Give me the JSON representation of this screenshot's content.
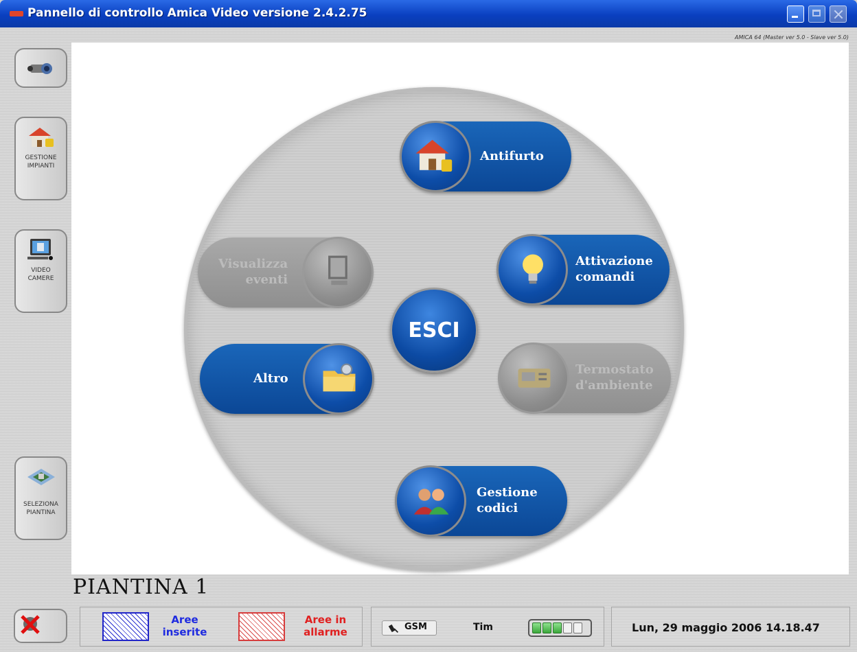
{
  "window": {
    "title": "Pannello di controllo Amica Video versione 2.4.2.75",
    "version_note": "AMICA 64 (Master ver 5.0 - Slave ver 5.0)"
  },
  "sidebar": {
    "items": [
      {
        "label": "",
        "icon": "camera-video-icon"
      },
      {
        "label": "GESTIONE\nIMPIANTI",
        "icon": "house-lock-icon"
      },
      {
        "label": "VIDEO\nCAMERE",
        "icon": "monitor-camera-icon"
      },
      {
        "label": "SELEZIONA\nPIANTINA",
        "icon": "floor-plan-icon"
      }
    ]
  },
  "menu": {
    "antifurto": "Antifurto",
    "attivazione_comandi": "Attivazione\ncomandi",
    "visualizza_eventi": "Visualizza\neventi",
    "termostato": "Termostato\nd'ambiente",
    "altro": "Altro",
    "gestione_codici": "Gestione\ncodici",
    "esci": "ESCI"
  },
  "map_name": "PIANTINA 1",
  "status": {
    "aree_inserite": "Aree\ninserite",
    "aree_allarme": "Aree in\nallarme",
    "gsm": "GSM",
    "operator": "Tim",
    "signal_bars_on": 3,
    "signal_bars_total": 5,
    "datetime": "Lun, 29 maggio 2006  14.18.47"
  },
  "colors": {
    "titlebar": "#0a3fc0",
    "button_blue": "#0b4796",
    "disabled_gray": "#8f8f8f",
    "inserite": "#1f2be0",
    "allarme": "#e02020"
  }
}
